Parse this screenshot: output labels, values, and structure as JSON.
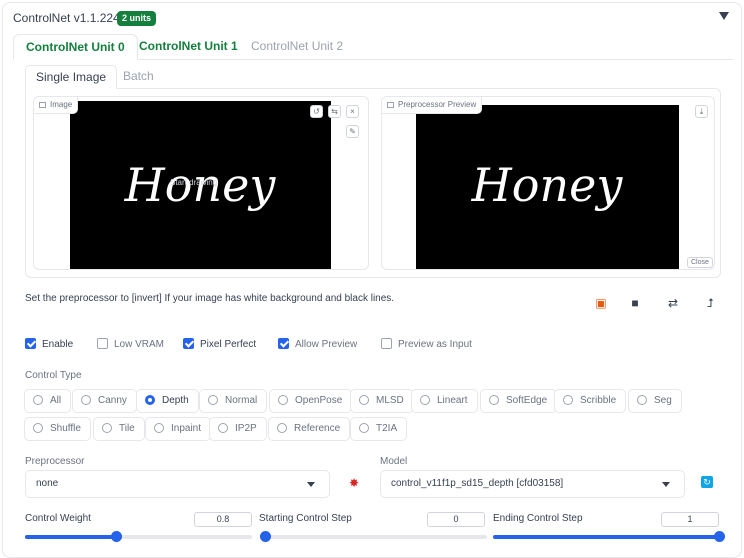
{
  "header": {
    "title": "ControlNet v1.1.224",
    "badge": "2 units"
  },
  "unit_tabs": [
    "ControlNet Unit 0",
    "ControlNet Unit 1",
    "ControlNet Unit 2"
  ],
  "image_tabs": [
    "Single Image",
    "Batch"
  ],
  "image_panel": {
    "label": "Image",
    "overlay_text": "Start drawing",
    "canvas_text": "Honey"
  },
  "preview_panel": {
    "label": "Preprocessor Preview",
    "canvas_text": "Honey",
    "close_label": "Close"
  },
  "hint": "Set the preprocessor to [invert] If your image has white background and black lines.",
  "toolbar": {
    "swap_symbol": "⇄",
    "send_symbol": "⮥"
  },
  "checkboxes": [
    {
      "label": "Enable",
      "checked": true
    },
    {
      "label": "Low VRAM",
      "checked": false
    },
    {
      "label": "Pixel Perfect",
      "checked": true
    },
    {
      "label": "Allow Preview",
      "checked": true
    },
    {
      "label": "Preview as Input",
      "checked": false
    }
  ],
  "control_type": {
    "label": "Control Type",
    "options_row1": [
      "All",
      "Canny",
      "Depth",
      "Normal",
      "OpenPose",
      "MLSD",
      "Lineart",
      "SoftEdge",
      "Scribble",
      "Seg"
    ],
    "options_row2": [
      "Shuffle",
      "Tile",
      "Inpaint",
      "IP2P",
      "Reference",
      "T2IA"
    ],
    "selected": "Depth"
  },
  "preprocessor": {
    "label": "Preprocessor",
    "value": "none"
  },
  "model": {
    "label": "Model",
    "value": "control_v11f1p_sd15_depth [cfd03158]"
  },
  "sliders": {
    "weight": {
      "label": "Control Weight",
      "value": "0.8",
      "fraction": 0.4
    },
    "start": {
      "label": "Starting Control Step",
      "value": "0",
      "fraction": 0.0
    },
    "end": {
      "label": "Ending Control Step",
      "value": "1",
      "fraction": 1.0
    }
  },
  "colors": {
    "accent": "#2563eb",
    "badge": "#15803d",
    "tab_active": "#15803d"
  }
}
